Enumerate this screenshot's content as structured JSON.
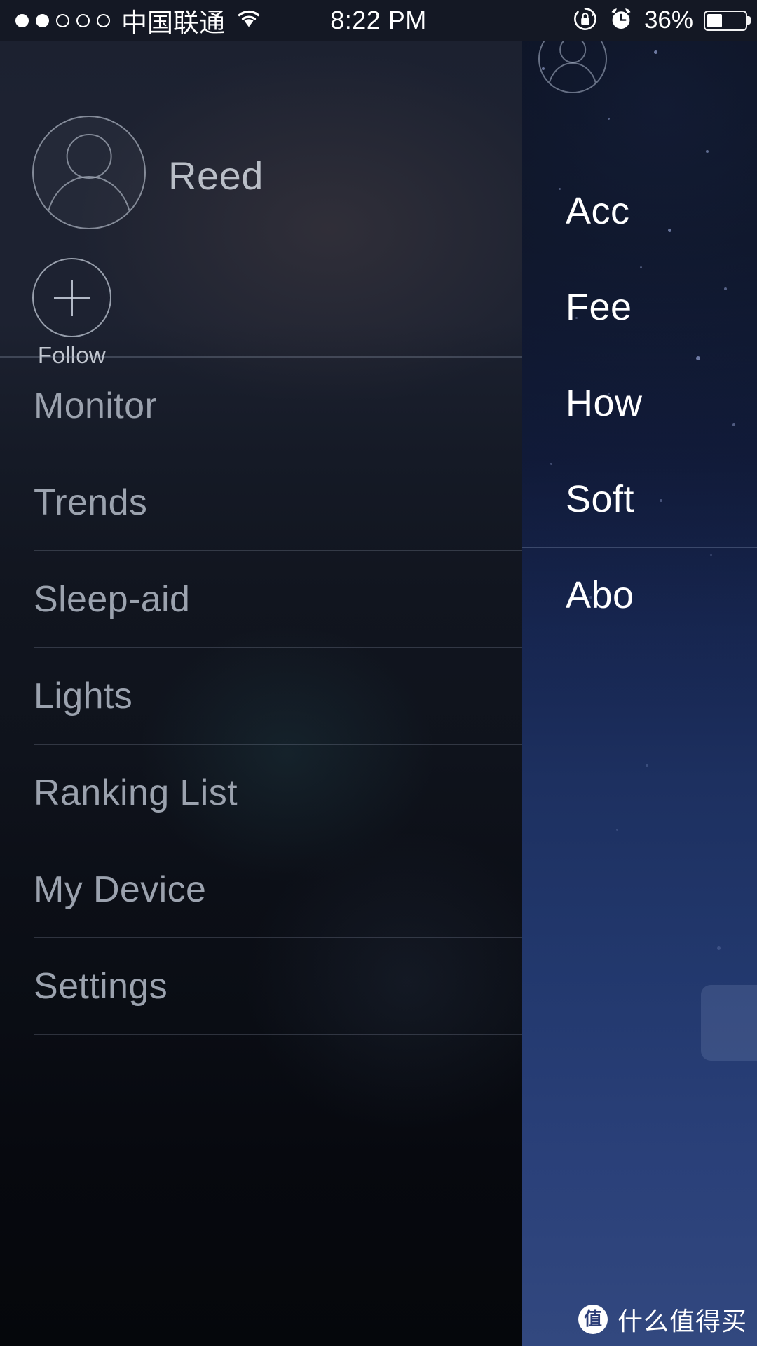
{
  "status_bar": {
    "signal_dots_total": 5,
    "signal_dots_filled": 2,
    "carrier": "中国联通",
    "wifi_icon": "wifi-icon",
    "time": "8:22 PM",
    "rotation_lock_icon": "rotation-lock-icon",
    "alarm_icon": "alarm-clock-icon",
    "battery_percent": "36%",
    "battery_level": 36
  },
  "drawer": {
    "profile": {
      "avatar_icon": "user-avatar-icon",
      "username": "Reed",
      "follow_icon": "plus-icon",
      "follow_label": "Follow"
    },
    "menu_items": [
      {
        "label": "Monitor"
      },
      {
        "label": "Trends"
      },
      {
        "label": "Sleep-aid"
      },
      {
        "label": "Lights"
      },
      {
        "label": "Ranking List"
      },
      {
        "label": "My Device"
      },
      {
        "label": "Settings"
      }
    ]
  },
  "under_panel": {
    "avatar_icon": "user-avatar-icon",
    "menu_items": [
      {
        "label": "Acc"
      },
      {
        "label": "Fee"
      },
      {
        "label": "How"
      },
      {
        "label": "Soft"
      },
      {
        "label": "Abo"
      }
    ]
  },
  "watermark": {
    "badge": "值",
    "text": "什么值得买"
  },
  "colors": {
    "drawer_bg": "#11151f",
    "under_panel_top": "#05070e",
    "under_panel_bottom": "#32487f",
    "menu_text": "#9ba2ae",
    "under_menu_text": "#ffffff",
    "divider": "#96a0b4",
    "status_bar_bg": "#141824"
  }
}
